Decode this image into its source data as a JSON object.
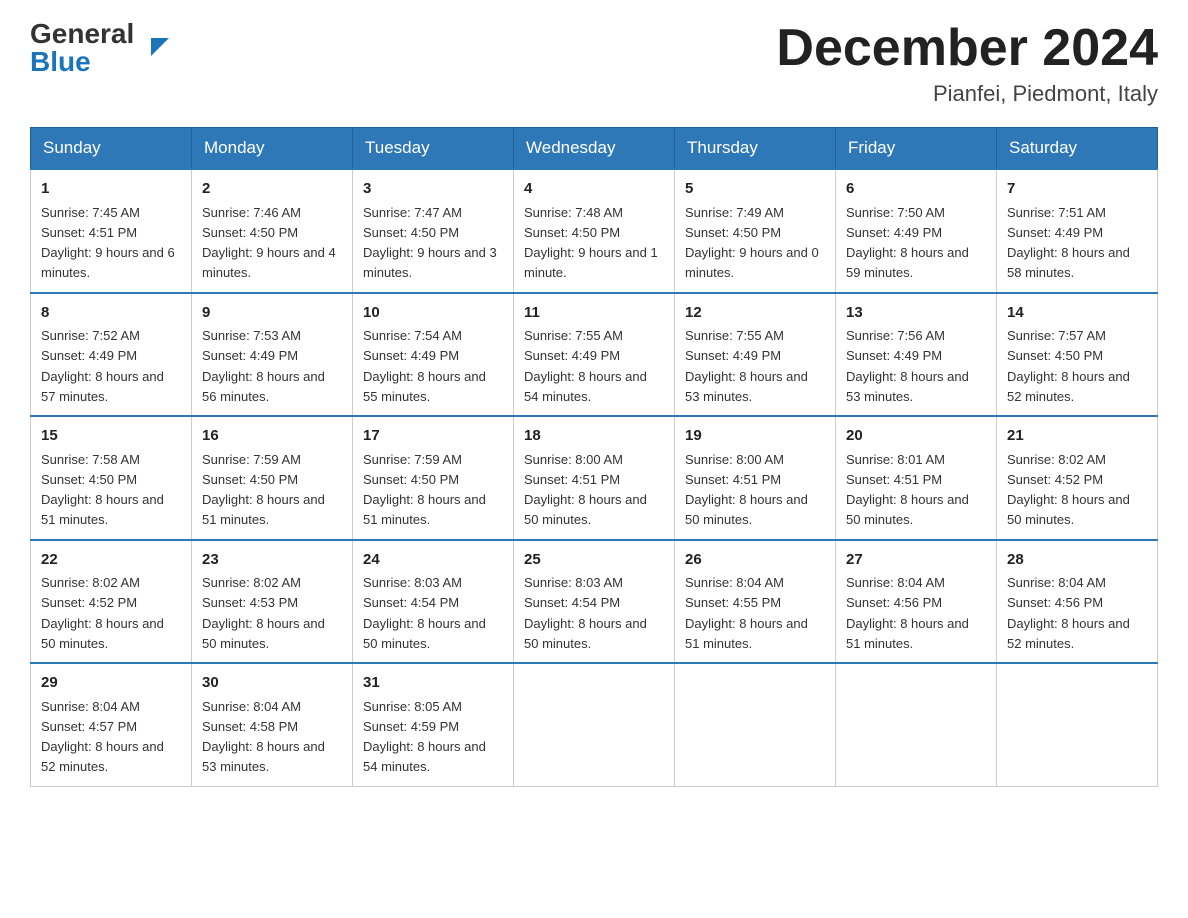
{
  "logo": {
    "general": "General",
    "blue": "Blue",
    "arrow": "▶"
  },
  "title": "December 2024",
  "location": "Pianfei, Piedmont, Italy",
  "days_of_week": [
    "Sunday",
    "Monday",
    "Tuesday",
    "Wednesday",
    "Thursday",
    "Friday",
    "Saturday"
  ],
  "weeks": [
    [
      {
        "day": "1",
        "sunrise": "7:45 AM",
        "sunset": "4:51 PM",
        "daylight": "9 hours and 6 minutes."
      },
      {
        "day": "2",
        "sunrise": "7:46 AM",
        "sunset": "4:50 PM",
        "daylight": "9 hours and 4 minutes."
      },
      {
        "day": "3",
        "sunrise": "7:47 AM",
        "sunset": "4:50 PM",
        "daylight": "9 hours and 3 minutes."
      },
      {
        "day": "4",
        "sunrise": "7:48 AM",
        "sunset": "4:50 PM",
        "daylight": "9 hours and 1 minute."
      },
      {
        "day": "5",
        "sunrise": "7:49 AM",
        "sunset": "4:50 PM",
        "daylight": "9 hours and 0 minutes."
      },
      {
        "day": "6",
        "sunrise": "7:50 AM",
        "sunset": "4:49 PM",
        "daylight": "8 hours and 59 minutes."
      },
      {
        "day": "7",
        "sunrise": "7:51 AM",
        "sunset": "4:49 PM",
        "daylight": "8 hours and 58 minutes."
      }
    ],
    [
      {
        "day": "8",
        "sunrise": "7:52 AM",
        "sunset": "4:49 PM",
        "daylight": "8 hours and 57 minutes."
      },
      {
        "day": "9",
        "sunrise": "7:53 AM",
        "sunset": "4:49 PM",
        "daylight": "8 hours and 56 minutes."
      },
      {
        "day": "10",
        "sunrise": "7:54 AM",
        "sunset": "4:49 PM",
        "daylight": "8 hours and 55 minutes."
      },
      {
        "day": "11",
        "sunrise": "7:55 AM",
        "sunset": "4:49 PM",
        "daylight": "8 hours and 54 minutes."
      },
      {
        "day": "12",
        "sunrise": "7:55 AM",
        "sunset": "4:49 PM",
        "daylight": "8 hours and 53 minutes."
      },
      {
        "day": "13",
        "sunrise": "7:56 AM",
        "sunset": "4:49 PM",
        "daylight": "8 hours and 53 minutes."
      },
      {
        "day": "14",
        "sunrise": "7:57 AM",
        "sunset": "4:50 PM",
        "daylight": "8 hours and 52 minutes."
      }
    ],
    [
      {
        "day": "15",
        "sunrise": "7:58 AM",
        "sunset": "4:50 PM",
        "daylight": "8 hours and 51 minutes."
      },
      {
        "day": "16",
        "sunrise": "7:59 AM",
        "sunset": "4:50 PM",
        "daylight": "8 hours and 51 minutes."
      },
      {
        "day": "17",
        "sunrise": "7:59 AM",
        "sunset": "4:50 PM",
        "daylight": "8 hours and 51 minutes."
      },
      {
        "day": "18",
        "sunrise": "8:00 AM",
        "sunset": "4:51 PM",
        "daylight": "8 hours and 50 minutes."
      },
      {
        "day": "19",
        "sunrise": "8:00 AM",
        "sunset": "4:51 PM",
        "daylight": "8 hours and 50 minutes."
      },
      {
        "day": "20",
        "sunrise": "8:01 AM",
        "sunset": "4:51 PM",
        "daylight": "8 hours and 50 minutes."
      },
      {
        "day": "21",
        "sunrise": "8:02 AM",
        "sunset": "4:52 PM",
        "daylight": "8 hours and 50 minutes."
      }
    ],
    [
      {
        "day": "22",
        "sunrise": "8:02 AM",
        "sunset": "4:52 PM",
        "daylight": "8 hours and 50 minutes."
      },
      {
        "day": "23",
        "sunrise": "8:02 AM",
        "sunset": "4:53 PM",
        "daylight": "8 hours and 50 minutes."
      },
      {
        "day": "24",
        "sunrise": "8:03 AM",
        "sunset": "4:54 PM",
        "daylight": "8 hours and 50 minutes."
      },
      {
        "day": "25",
        "sunrise": "8:03 AM",
        "sunset": "4:54 PM",
        "daylight": "8 hours and 50 minutes."
      },
      {
        "day": "26",
        "sunrise": "8:04 AM",
        "sunset": "4:55 PM",
        "daylight": "8 hours and 51 minutes."
      },
      {
        "day": "27",
        "sunrise": "8:04 AM",
        "sunset": "4:56 PM",
        "daylight": "8 hours and 51 minutes."
      },
      {
        "day": "28",
        "sunrise": "8:04 AM",
        "sunset": "4:56 PM",
        "daylight": "8 hours and 52 minutes."
      }
    ],
    [
      {
        "day": "29",
        "sunrise": "8:04 AM",
        "sunset": "4:57 PM",
        "daylight": "8 hours and 52 minutes."
      },
      {
        "day": "30",
        "sunrise": "8:04 AM",
        "sunset": "4:58 PM",
        "daylight": "8 hours and 53 minutes."
      },
      {
        "day": "31",
        "sunrise": "8:05 AM",
        "sunset": "4:59 PM",
        "daylight": "8 hours and 54 minutes."
      },
      null,
      null,
      null,
      null
    ]
  ]
}
